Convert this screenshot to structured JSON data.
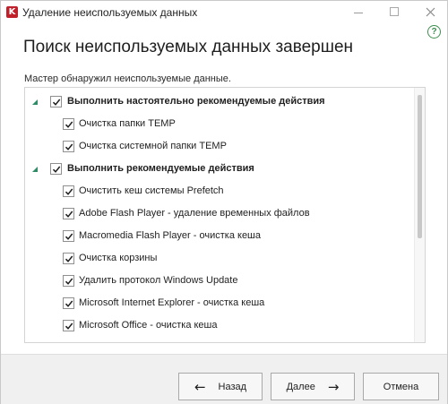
{
  "window": {
    "title": "Удаление неиспользуемых данных",
    "logo_letter": "K",
    "help_symbol": "?"
  },
  "main": {
    "heading": "Поиск неиспользуемых данных завершен",
    "description": "Мастер обнаружил неиспользуемые данные."
  },
  "list": {
    "groups": [
      {
        "label": "Выполнить настоятельно рекомендуемые действия",
        "checked": true,
        "items": [
          {
            "label": "Очистка папки TEMP",
            "checked": true
          },
          {
            "label": "Очистка системной папки TEMP",
            "checked": true
          }
        ]
      },
      {
        "label": "Выполнить рекомендуемые действия",
        "checked": true,
        "items": [
          {
            "label": "Очистить кеш системы Prefetch",
            "checked": true
          },
          {
            "label": "Adobe Flash Player - удаление временных файлов",
            "checked": true
          },
          {
            "label": "Macromedia Flash Player - очистка кеша",
            "checked": true
          },
          {
            "label": "Очистка корзины",
            "checked": true
          },
          {
            "label": "Удалить протокол Windows Update",
            "checked": true
          },
          {
            "label": "Microsoft Internet Explorer - очистка кеша",
            "checked": true
          },
          {
            "label": "Microsoft Office - очистка кеша",
            "checked": true
          }
        ]
      }
    ]
  },
  "footer": {
    "back_label": "Назад",
    "back_arrow": "←",
    "next_label": "Далее",
    "next_arrow": "→",
    "cancel_label": "Отмена"
  },
  "colors": {
    "accent_green": "#2e8b66",
    "help_green": "#3d8f4f",
    "brand_red": "#c0202a"
  }
}
